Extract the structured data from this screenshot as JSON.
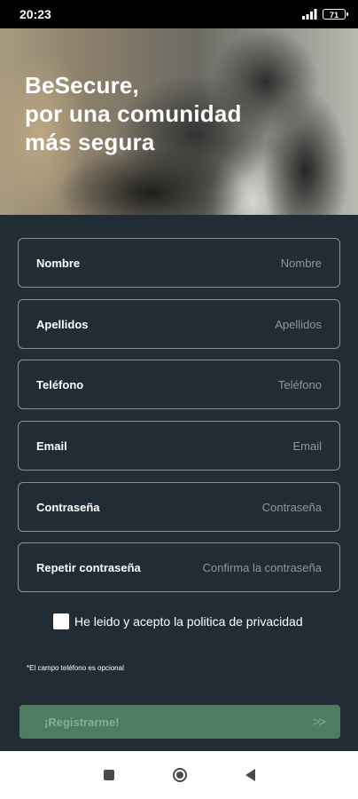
{
  "status_bar": {
    "time": "20:23",
    "signal_icon": "cellular-signal-icon",
    "battery_level": "71"
  },
  "hero": {
    "title": "BeSecure,\npor una comunidad\nmás segura"
  },
  "form": {
    "fields": [
      {
        "label": "Nombre",
        "placeholder": "Nombre",
        "value": ""
      },
      {
        "label": "Apellidos",
        "placeholder": "Apellidos",
        "value": ""
      },
      {
        "label": "Teléfono",
        "placeholder": "Teléfono",
        "value": ""
      },
      {
        "label": "Email",
        "placeholder": "Email",
        "value": ""
      },
      {
        "label": "Contraseña",
        "placeholder": "Contraseña",
        "value": ""
      },
      {
        "label": "Repetir contraseña",
        "placeholder": "Confirma la contraseña",
        "value": ""
      }
    ],
    "privacy_checkbox_checked": false,
    "privacy_label": "He leido y acepto la politica de privacidad",
    "phone_optional_note": "*El campo teléfono es opcional",
    "register_button": {
      "label": "¡Registrarme!",
      "arrows": ">>"
    }
  },
  "nav_bar": {
    "icons": [
      "recents-square-icon",
      "home-circle-icon",
      "back-triangle-icon"
    ]
  },
  "colors": {
    "form_background": "#212c35",
    "field_border": "#8a9298",
    "button_background": "#4d7c63",
    "button_text": "#86ad96"
  }
}
